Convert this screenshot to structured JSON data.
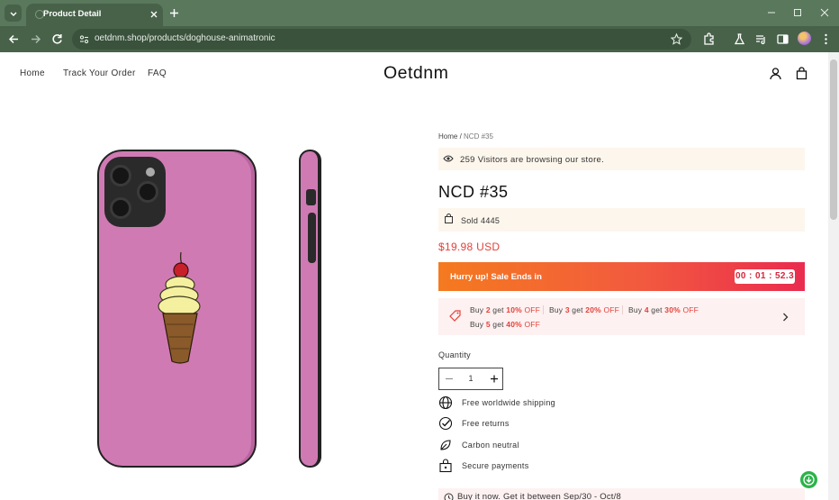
{
  "browser": {
    "tab_title": "Product Detail",
    "url": "oetdnm.shop/products/doghouse-animatronic",
    "icons": [
      "tab-search-icon",
      "tab-close-icon",
      "new-tab-icon",
      "minimize-icon",
      "maximize-icon",
      "window-close-icon",
      "back-icon",
      "forward-icon",
      "reload-icon",
      "site-info-icon",
      "bookmark-star-icon",
      "extensions-icon",
      "labs-icon",
      "media-icon",
      "side-panel-icon",
      "profile-avatar",
      "menu-icon"
    ]
  },
  "header": {
    "nav": [
      "Home",
      "Track Your Order",
      "FAQ"
    ],
    "logo": "Oetdnm"
  },
  "product": {
    "breadcrumb": {
      "home": "Home",
      "separator": " / ",
      "current": "NCD #35"
    },
    "visitors_text": "259 Visitors are browsing our store.",
    "title": "NCD #35",
    "sold_text": "Sold 4445",
    "price": "$19.98 USD",
    "sale": {
      "label": "Hurry up! Sale Ends in",
      "timer": "00 : 01 : 52.3"
    },
    "offers": [
      {
        "pre": "Buy ",
        "qty": "2",
        "mid": " get ",
        "pct": "10%",
        "post": " OFF"
      },
      {
        "pre": "Buy ",
        "qty": "3",
        "mid": " get ",
        "pct": "20%",
        "post": " OFF"
      },
      {
        "pre": "Buy ",
        "qty": "4",
        "mid": " get ",
        "pct": "30%",
        "post": " OFF"
      },
      {
        "pre": "Buy ",
        "qty": "5",
        "mid": " get ",
        "pct": "40%",
        "post": " OFF"
      }
    ],
    "quantity": {
      "label": "Quantity",
      "value": "1"
    },
    "features": [
      "Free worldwide shipping",
      "Free returns",
      "Carbon neutral",
      "Secure payments"
    ],
    "delivery_text": "Buy it now. Get it between Sep/30 - Oct/8"
  },
  "colors": {
    "chrome": "#5a785c",
    "price": "#e3423a",
    "sale_gradient_start": "#f57a1f",
    "sale_gradient_end": "#ea2b4e",
    "case": "#d07ab4"
  }
}
